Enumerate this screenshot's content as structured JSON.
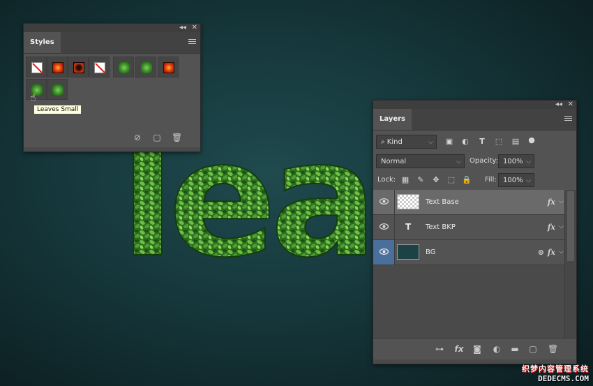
{
  "canvas": {
    "text": "lea"
  },
  "styles_panel": {
    "tab_label": "Styles",
    "collapse_glyph": "◂◂",
    "close_glyph": "✕",
    "swatches": [
      {
        "kind": "none"
      },
      {
        "kind": "red"
      },
      {
        "kind": "dark"
      },
      {
        "kind": "none"
      },
      {
        "kind": "green"
      },
      {
        "kind": "green"
      },
      {
        "kind": "red"
      },
      {
        "kind": "green"
      },
      {
        "kind": "green"
      }
    ],
    "tooltip": "Leaves Small",
    "footer_icons": [
      "delete-style-icon",
      "new-style-icon",
      "trash-icon"
    ]
  },
  "layers_panel": {
    "tab_label": "Layers",
    "collapse_glyph": "◂◂",
    "close_glyph": "✕",
    "filter": {
      "value": "Kind",
      "search_glyph": "⌕"
    },
    "blend_mode": "Normal",
    "opacity_label": "Opacity:",
    "opacity_value": "100%",
    "lock_label": "Lock:",
    "fill_label": "Fill:",
    "fill_value": "100%",
    "layers": [
      {
        "name": "Text Base",
        "fx": "fx",
        "selected": true,
        "type": "pixel"
      },
      {
        "name": "Text BKP",
        "fx": "fx",
        "selected": false,
        "type": "text"
      },
      {
        "name": "BG",
        "fx": "fx",
        "selected": false,
        "type": "smart"
      }
    ],
    "text_layer_glyph": "T",
    "footer_icons": [
      "link-icon",
      "fx-icon",
      "mask-icon",
      "adjustment-icon",
      "folder-icon",
      "new-layer-icon",
      "trash-icon"
    ],
    "footer_fx_label": "fx"
  },
  "watermark": {
    "line1": "织梦内容管理系统",
    "line2": "DEDECMS.COM"
  },
  "colors": {
    "accent_blue": "#4a6f9a",
    "leaf_green": "#3d8e2a",
    "panel_bg": "#535353"
  }
}
